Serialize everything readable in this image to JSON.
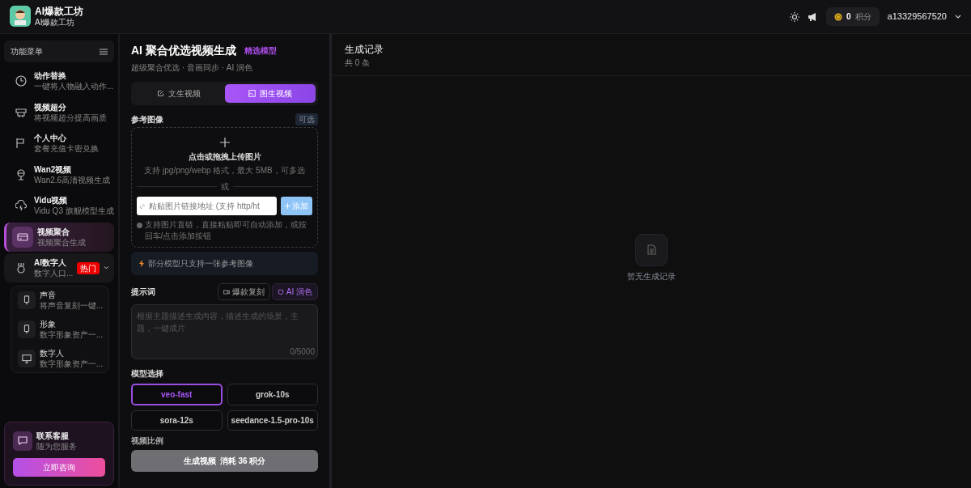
{
  "header": {
    "app_name": "AI爆款工坊",
    "app_subtitle": "AI爆款工坊",
    "points_value": "0",
    "points_unit": "积分",
    "username": "a13329567520"
  },
  "sidebar": {
    "title": "功能菜单",
    "items": [
      {
        "title": "动作替换",
        "subtitle": "一键将人物融入动作...",
        "selected": false
      },
      {
        "title": "视频超分",
        "subtitle": "将视频超分提高画质",
        "selected": false
      },
      {
        "title": "个人中心",
        "subtitle": "套餐充值卡密兑换",
        "selected": false
      },
      {
        "title": "Wan2视频",
        "subtitle": "Wan2.6高清视频生成",
        "selected": false
      },
      {
        "title": "Vidu视频",
        "subtitle": "Vidu Q3 旗舰模型生成",
        "selected": false
      },
      {
        "title": "视频聚合",
        "subtitle": "视频聚合生成",
        "selected": true
      },
      {
        "title": "AI数字人",
        "subtitle": "数字人口...",
        "selected": false,
        "badge": "热门",
        "expanded": true,
        "children": [
          {
            "title": "声音",
            "subtitle": "将声音复刻一键..."
          },
          {
            "title": "形象",
            "subtitle": "数字形象资产一..."
          },
          {
            "title": "数字人",
            "subtitle": "数字形象资产一..."
          }
        ]
      }
    ]
  },
  "contact": {
    "title": "联系客服",
    "subtitle": "随为您服务",
    "button": "立即咨询"
  },
  "panel": {
    "title": "AI 聚合优选视频生成",
    "tag": "精选模型",
    "subtitle": "超级聚合优选 · 音画同步 · AI 润色",
    "tabs": [
      {
        "label": "文生视频",
        "selected": false
      },
      {
        "label": "图生视频",
        "selected": true
      }
    ],
    "reference": {
      "label": "参考图像",
      "tag": "可选",
      "upload_title": "点击或拖拽上传图片",
      "upload_hint": "支持 jpg/png/webp 格式，最大 5MB，可多选",
      "divider": "或",
      "url_placeholder": "粘贴图片链接地址 (支持 http/ht",
      "add_button": "添加",
      "help": "支持图片直链，直接粘贴即可自动添加，或按回车/点击添加按钮"
    },
    "notice": "部分模型只支持一张参考图像",
    "prompt": {
      "label": "提示词",
      "buttons": [
        "爆款复刻",
        "AI 润色"
      ],
      "placeholder": "根据主题描述生成内容，描述生成的场景，主题，一键成片",
      "counter": "0/5000"
    },
    "models": {
      "label": "模型选择",
      "options": [
        {
          "label": "veo-fast",
          "selected": true
        },
        {
          "label": "grok-10s",
          "selected": false
        },
        {
          "label": "sora-12s",
          "selected": false
        },
        {
          "label": "seedance-1.5-pro-10s",
          "selected": false
        }
      ]
    },
    "ratio_label": "视频比例",
    "generate": {
      "label": "生成视频",
      "cost": "消耗 36 积分"
    }
  },
  "records": {
    "title": "生成记录",
    "count": "共 0 条",
    "empty": "暂无生成记录"
  }
}
